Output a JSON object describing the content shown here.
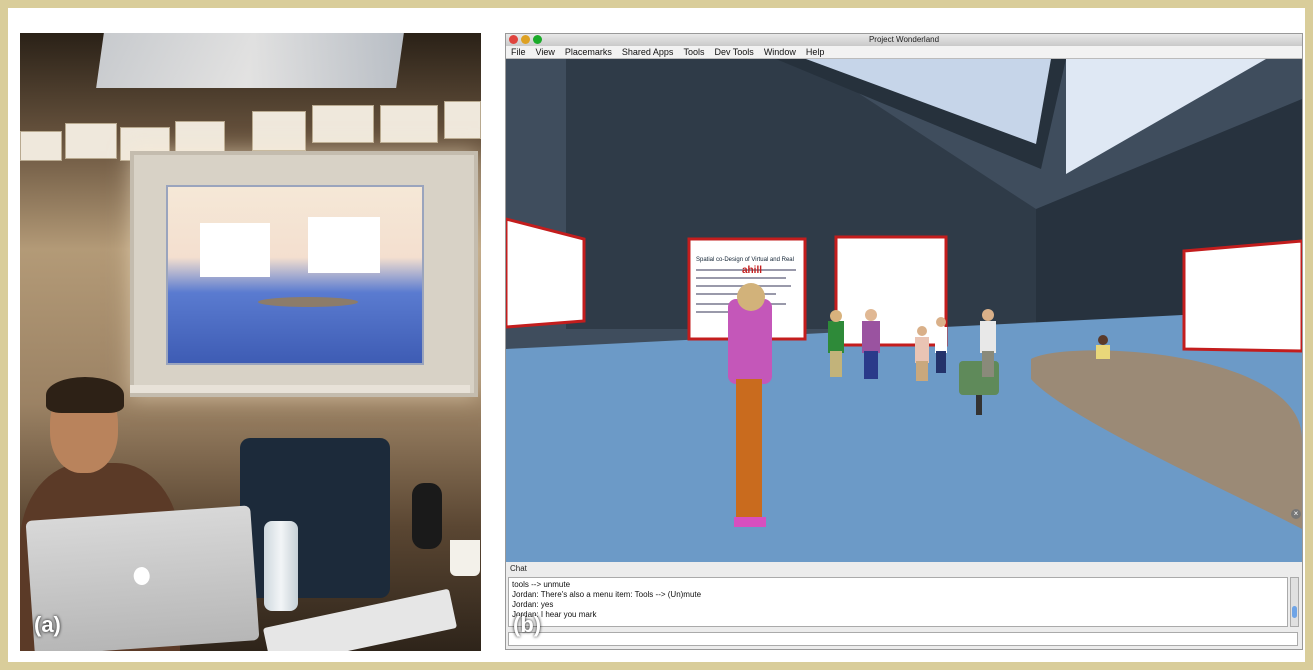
{
  "panel_a": {
    "label": "(a)"
  },
  "panel_b": {
    "label": "(b)",
    "window": {
      "title": "Project Wonderland"
    },
    "menu": [
      "File",
      "View",
      "Placemarks",
      "Shared Apps",
      "Tools",
      "Dev Tools",
      "Window",
      "Help"
    ],
    "scene": {
      "avatar_name": "ahill",
      "slide_title": "Spatial co-Design of Virtual and Real"
    },
    "chat": {
      "header": "Chat",
      "lines": [
        "tools --> unmute",
        "Jordan: There's also a menu item: Tools --> (Un)mute",
        "Jordan: yes",
        "Jordan: I hear you mark"
      ]
    }
  },
  "colors": {
    "frame": "#d9cd9a",
    "floor": "#6c9ac7",
    "wall": "#4a5a6a",
    "accent_red": "#c31d1d"
  }
}
